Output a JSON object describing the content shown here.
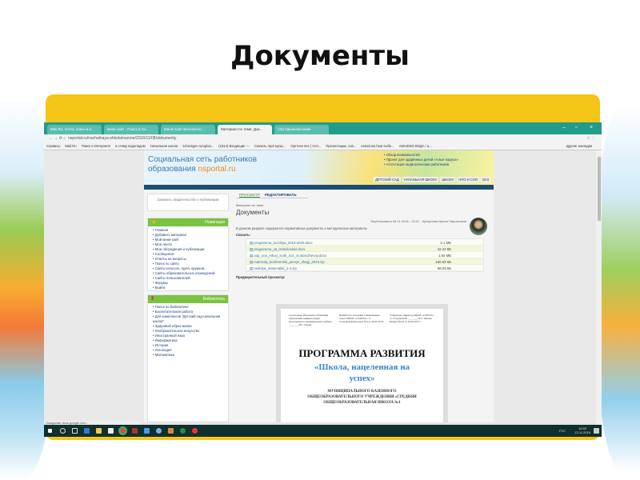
{
  "slide": {
    "title": "Документы"
  },
  "browser": {
    "tabs": [
      "Mail.Ru: почта, поиск в и...",
      "мини сайт - Поиск в Go...",
      "Мини-Сайт Бесплатно ...",
      "Материал по теме: Док...",
      "(43) Одноклассники"
    ],
    "url": "nsportal.ru/nachalnaya-shkola/raznoe/2016/11/08/dokumenty",
    "bookmarks": [
      "Сервисы",
      "Mail.Ru",
      "Поиск в Интернете",
      "в стиму водопадом",
      "Начальная школа",
      "schoolgen.ru/uploa...",
      "(1914) Входящие —",
      "Скачать mp3 музы...",
      "Оргтехн ясе | Сеп...",
      "Презентации, сов...",
      "essoznan.hear.ru/do...",
      "AMAZING ВОДА / a..."
    ],
    "other_bookmarks": "Другие закладки",
    "status": "Ожидание docs.google.com...",
    "clock": {
      "time": "16:53",
      "date": "12.11.2016",
      "lang": "РУС"
    }
  },
  "site": {
    "title_line1": "Социальная сеть работников",
    "title_line2_prefix": "образования ",
    "title_brand": "nsportal.ru",
    "header_links": [
      "Обзор возможностей",
      "Проект для одарённых детей «Алые паруса»",
      "Аттестация педагогических работников"
    ],
    "level_tabs": [
      "ДЕТСКИЙ САД",
      "НАЧАЛЬНАЯ ШКОЛА",
      "ШКОЛА",
      "НПО И СПО",
      "ВУЗ"
    ],
    "certificate_link": "Заказать свидетельство о публикации",
    "nav_title": "Навигация",
    "nav_items": [
      "Главная",
      "Добавить материал",
      "Мой мини-сайт",
      "Моя лента",
      "Мои обсуждения и публикации",
      "Сообщения",
      "Ответы на вопросы",
      "Поиск по сайту",
      "Сайты классов, групп, кружков...",
      "Сайты образовательных учреждений",
      "Сайты пользователей",
      "Форумы",
      "Выйти"
    ],
    "library_title": "Библиотека",
    "library_items": [
      "Поиск по библиотеке",
      "Воспитательная работа",
      "Для комплексов \"Детский сад-начальная школа\"",
      "Здоровый образ жизни",
      "Изобразительное искусство",
      "Иностранный язык",
      "Информатика",
      "История",
      "Логопедия",
      "Математика"
    ],
    "view_tabs": [
      "ПРОСМОТР",
      "РЕДАКТИРОВАТЬ"
    ],
    "material_label": "Материал по теме:",
    "page_title": "Документы",
    "published": "Опубликовано 08.11.2016 - 13:22 - Крикунова Ирина Гавриловна",
    "description": "В данном разделе содержатся нормативные документы и методические материалы",
    "download_label": "Скачать:",
    "files": [
      {
        "name": "programma_razvitiya_2015-2020.docx",
        "size": "2.1 МБ"
      },
      {
        "name": "programma_ya_issledovatel.docx",
        "size": "42.23 КБ"
      },
      {
        "name": "oop_ooo_mkou_sosh_no1_st.storozhevoy.docx",
        "size": "1.64 МБ"
      },
      {
        "name": "materialy_konferentsii_pervye_shagi_2015.zip",
        "size": "166.93 КБ"
      },
      {
        "name": "nedelya_matematiki_1-4.zip",
        "size": "68.03 КБ"
      }
    ],
    "preview_label": "Предварительный просмотр:",
    "doc": {
      "col1": "Согласовано Начальник управления образования администрации Белоглинского муниципального района ________В.Г. Лохова",
      "col2": "Принято на заседании Управляющего совета МКОУ «СОШ №1» ст. Сторожевой Протокол №4 от 29.05.2015г.",
      "col3": "Утверждаю Директор МКОУ «СОШ №1 ст. Сторожевой» ________И.С. Попова Приказ №27а от 29.05.2015 г.",
      "heading": "ПРОГРАММА РАЗВИТИЯ",
      "subheading": "«Школа, нацеленная на успех»",
      "org": "МУНИЦИПАЛЬНОГО КАЗЕННОГО ОБЩЕОБРАЗОВАТЕЛЬНОГО УЧРЕЖДЕНИЯ «СРЕДНЯЯ ОБЩЕОБРАЗОВАТЕЛЬНАЯ ШКОЛА №1"
    }
  }
}
